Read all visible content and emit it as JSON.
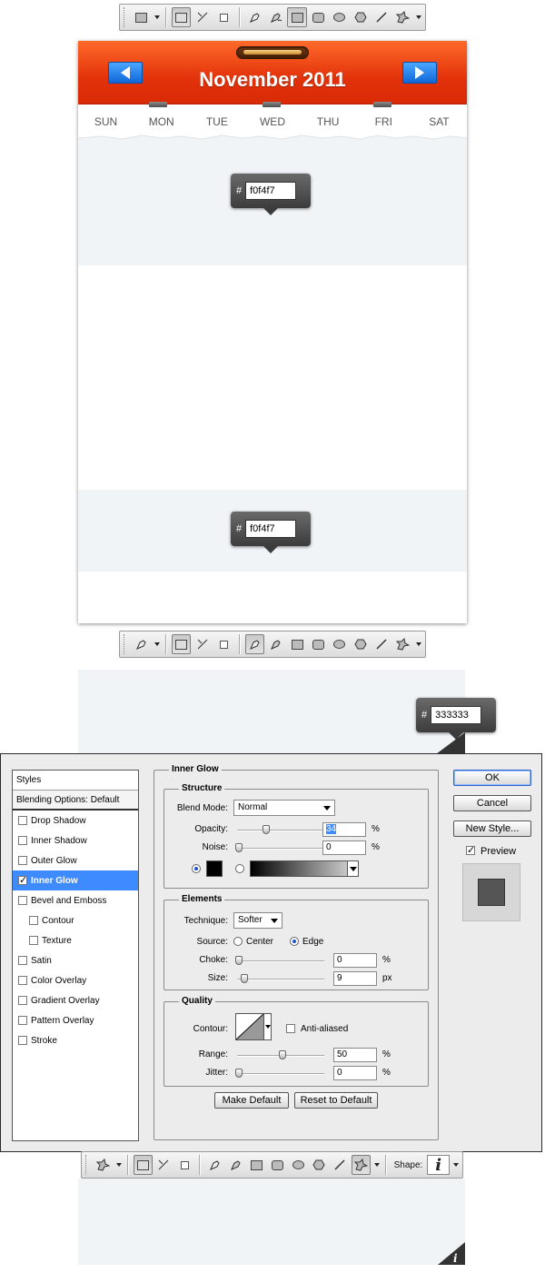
{
  "calendar": {
    "title": "November 2011",
    "weekdays": [
      "SUN",
      "MON",
      "TUE",
      "WED",
      "THU",
      "FRI",
      "SAT"
    ],
    "colors": {
      "header": "#e2320a",
      "nav": "#1067d8",
      "band": "#f0f4f7"
    }
  },
  "tooltips": {
    "hash": "#",
    "first": "f0f4f7",
    "second": "f0f4f7",
    "third": "333333"
  },
  "toolbars": {
    "top": {
      "icons": [
        "rectangle-tool-icon",
        "shape-layers-icon",
        "paths-icon",
        "fill-pixels-icon",
        "pen-icon",
        "freeform-pen-icon",
        "rectangle-icon",
        "rounded-rectangle-icon",
        "ellipse-icon",
        "polygon-icon",
        "line-icon",
        "custom-shape-icon"
      ]
    },
    "bottom": {
      "shape_label": "Shape:",
      "shape_value": "i"
    }
  },
  "dialog": {
    "styles_header": "Styles",
    "blending": "Blending Options: Default",
    "style_items": [
      {
        "label": "Drop Shadow",
        "checked": false
      },
      {
        "label": "Inner Shadow",
        "checked": false
      },
      {
        "label": "Outer Glow",
        "checked": false
      },
      {
        "label": "Inner Glow",
        "checked": true
      },
      {
        "label": "Bevel and Emboss",
        "checked": false
      },
      {
        "label": "Contour",
        "checked": false
      },
      {
        "label": "Texture",
        "checked": false
      },
      {
        "label": "Satin",
        "checked": false
      },
      {
        "label": "Color Overlay",
        "checked": false
      },
      {
        "label": "Gradient Overlay",
        "checked": false
      },
      {
        "label": "Pattern Overlay",
        "checked": false
      },
      {
        "label": "Stroke",
        "checked": false
      }
    ],
    "section_title": "Inner Glow",
    "structure": {
      "title": "Structure",
      "blend_mode_label": "Blend Mode:",
      "blend_mode": "Normal",
      "opacity_label": "Opacity:",
      "opacity": "34",
      "noise_label": "Noise:",
      "noise": "0",
      "percent": "%",
      "glow_color": "#000000"
    },
    "elements": {
      "title": "Elements",
      "technique_label": "Technique:",
      "technique": "Softer",
      "source_label": "Source:",
      "center": "Center",
      "edge": "Edge",
      "choke_label": "Choke:",
      "choke": "0",
      "size_label": "Size:",
      "size": "9",
      "px": "px"
    },
    "quality": {
      "title": "Quality",
      "contour_label": "Contour:",
      "anti_aliased": "Anti-aliased",
      "range_label": "Range:",
      "range": "50",
      "jitter_label": "Jitter:",
      "jitter": "0"
    },
    "buttons": {
      "make_default": "Make Default",
      "reset_default": "Reset to Default",
      "ok": "OK",
      "cancel": "Cancel",
      "new_style": "New Style...",
      "preview": "Preview"
    }
  }
}
